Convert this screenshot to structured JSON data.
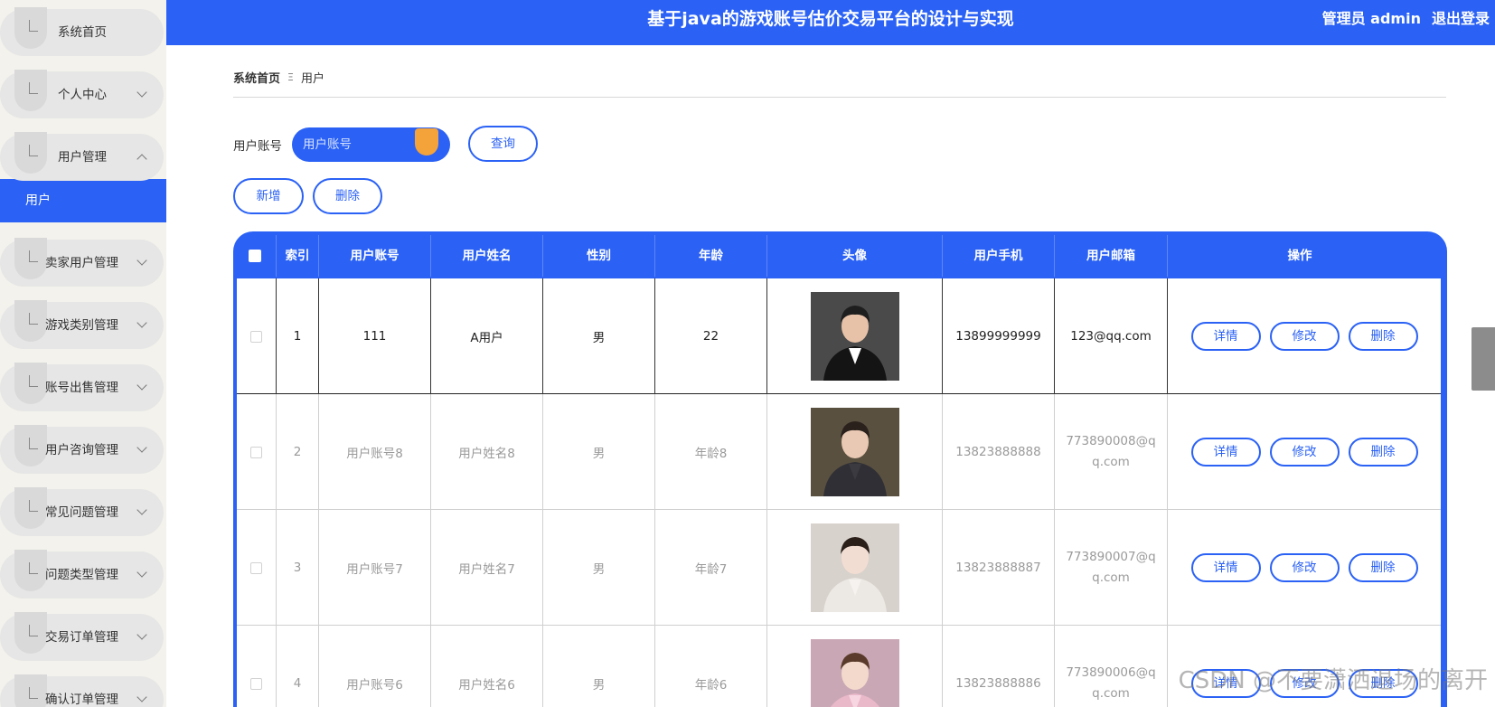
{
  "header": {
    "title": "基于java的游戏账号估价交易平台的设计与实现",
    "admin_label": "管理员 admin",
    "logout": "退出登录"
  },
  "sidebar": {
    "items": [
      {
        "label": "系统首页",
        "chevron": "none"
      },
      {
        "label": "个人中心",
        "chevron": "down"
      },
      {
        "label": "用户管理",
        "chevron": "up"
      },
      {
        "label": "卖家用户管理",
        "chevron": "down"
      },
      {
        "label": "游戏类别管理",
        "chevron": "down"
      },
      {
        "label": "账号出售管理",
        "chevron": "down"
      },
      {
        "label": "用户咨询管理",
        "chevron": "down"
      },
      {
        "label": "常见问题管理",
        "chevron": "down"
      },
      {
        "label": "问题类型管理",
        "chevron": "down"
      },
      {
        "label": "交易订单管理",
        "chevron": "down"
      },
      {
        "label": "确认订单管理",
        "chevron": "down"
      }
    ],
    "active_sub": "用户",
    "icon": "menu-icon"
  },
  "breadcrumb": {
    "home": "系统首页",
    "separator": "Ξ",
    "current": "用户"
  },
  "search": {
    "label": "用户账号",
    "placeholder": "用户账号",
    "value": "",
    "query_button": "查询"
  },
  "actions": {
    "add": "新增",
    "delete": "删除"
  },
  "table": {
    "headers": [
      "索引",
      "用户账号",
      "用户姓名",
      "性别",
      "年龄",
      "头像",
      "用户手机",
      "用户邮箱",
      "操作"
    ],
    "row_ops": {
      "detail": "详情",
      "edit": "修改",
      "delete": "删除"
    },
    "rows": [
      {
        "index": "1",
        "account": "111",
        "name": "A用户",
        "gender": "男",
        "age": "22",
        "phone": "13899999999",
        "email": "123@qq.com",
        "avatar": "man-in-suit"
      },
      {
        "index": "2",
        "account": "用户账号8",
        "name": "用户姓名8",
        "gender": "男",
        "age": "年龄8",
        "phone": "13823888888",
        "email": "773890008@qq.com",
        "avatar": "young-man"
      },
      {
        "index": "3",
        "account": "用户账号7",
        "name": "用户姓名7",
        "gender": "男",
        "age": "年龄7",
        "phone": "13823888887",
        "email": "773890007@qq.com",
        "avatar": "young-woman"
      },
      {
        "index": "4",
        "account": "用户账号6",
        "name": "用户姓名6",
        "gender": "男",
        "age": "年龄6",
        "phone": "13823888886",
        "email": "773890006@qq.com",
        "avatar": "woman-flowers"
      }
    ]
  },
  "watermark": "CSDN @不要潇洒退场的离开",
  "colors": {
    "primary": "#2b62f5",
    "sidebar_bg": "#f3f2ec",
    "knob": "#f4a23a"
  }
}
